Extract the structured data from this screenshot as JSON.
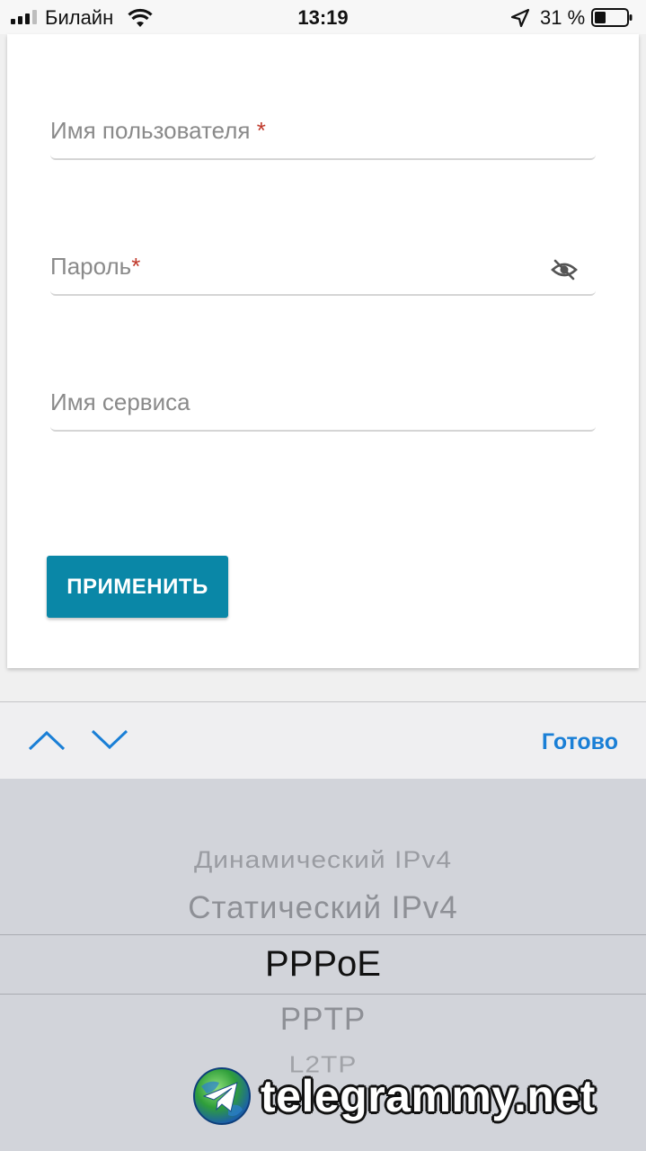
{
  "status_bar": {
    "carrier": "Билайн",
    "time": "13:19",
    "battery": "31 %",
    "icons": [
      "signal-icon",
      "wifi-icon",
      "location-icon",
      "battery-icon"
    ]
  },
  "form": {
    "username_label": "Имя пользователя ",
    "password_label": "Пароль",
    "required_mark": "*",
    "service_label": "Имя сервиса",
    "apply_button": "ПРИМЕНИТЬ"
  },
  "toolbar": {
    "done": "Готово"
  },
  "picker": {
    "options": [
      "Динамический IPv4",
      "Статический IPv4",
      "PPPoE",
      "PPTP",
      "L2TP"
    ],
    "selected": "PPPoE"
  },
  "watermark": {
    "text": "telegrammy.net"
  },
  "colors": {
    "accent": "#0a87a7",
    "link": "#1a7fd6",
    "required": "#c0392b",
    "picker_bg": "#d2d4da"
  }
}
